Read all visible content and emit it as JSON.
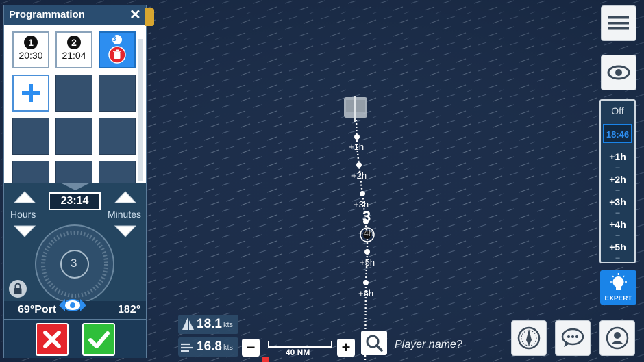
{
  "panel": {
    "title": "Programmation",
    "close_icon": "close-icon",
    "slots": [
      {
        "number": "1",
        "time": "20:30"
      },
      {
        "number": "2",
        "time": "21:04"
      },
      {
        "number": "3",
        "icon": "trash-icon",
        "selected": true
      }
    ],
    "add_icon": "plus-icon",
    "hours_label": "Hours",
    "minutes_label": "Minutes",
    "time_value": "23:14",
    "dial_number": "3",
    "heading_value": "69°Port",
    "wind_value": "182°",
    "cancel_icon": "x-icon",
    "confirm_icon": "check-icon",
    "lock_icon": "lock-icon",
    "colors": {
      "panel": "#1c3a58",
      "selected_slot": "#2d8ef0",
      "cancel": "#e5262d",
      "confirm": "#2fbf3a"
    }
  },
  "map": {
    "route_labels": [
      "+1h",
      "+2h",
      "+3h",
      "+4h",
      "+5h",
      "+6h"
    ],
    "waypoint_number": "3",
    "scale_label": "40 NM"
  },
  "toolbar": {
    "menu_icon": "hamburger-icon",
    "view_icon": "eye-icon",
    "timeline": {
      "off_label": "Off",
      "current_time": "18:46",
      "items": [
        "+1h",
        "+2h",
        "+3h",
        "+4h",
        "+5h"
      ]
    },
    "expert_label": "EXPERT",
    "expert_icon": "lightbulb-icon",
    "accent_color": "#1a84e8"
  },
  "bottom": {
    "boat_speed": "18.1",
    "boat_speed_unit": "kts",
    "wind_speed": "16.8",
    "wind_speed_unit": "kts",
    "zoom_out_label": "−",
    "zoom_in_label": "+",
    "scale_label": "40 NM",
    "search_icon": "magnifier-icon",
    "player_placeholder": "Player name?",
    "buttons": [
      "compass-icon",
      "chat-icon",
      "profile-icon"
    ]
  }
}
